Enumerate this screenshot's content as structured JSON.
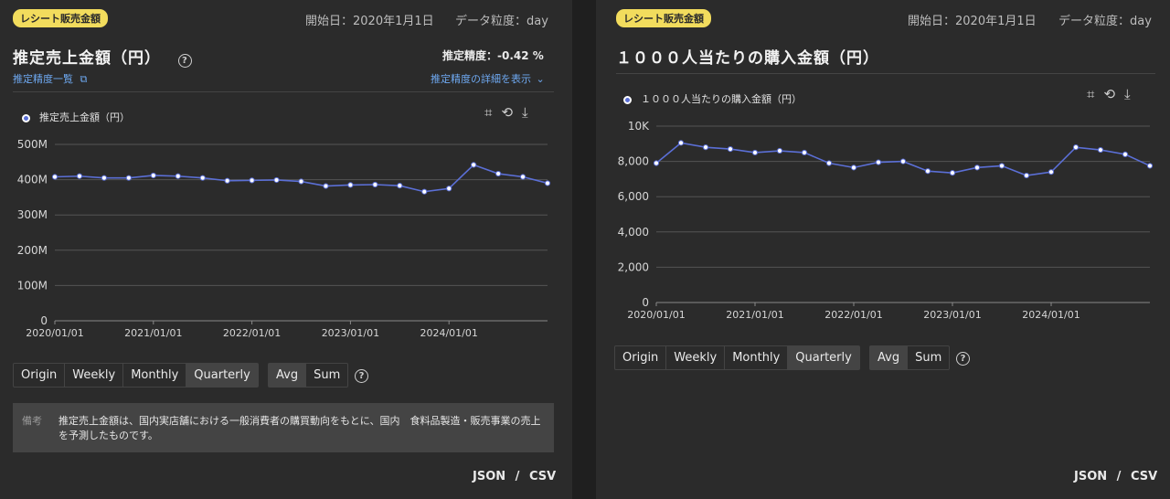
{
  "left": {
    "badge": "レシート販売金額",
    "start_date": "開始日：2020年1月1日",
    "granularity": "データ粒度：day",
    "title": "推定売上金額（円）",
    "accuracy": "推定精度：-0.42 %",
    "accuracy_list_link": "推定精度一覧",
    "accuracy_detail_link": "推定精度の詳細を表示",
    "legend": "推定売上金額（円）",
    "period_buttons": [
      "Origin",
      "Weekly",
      "Monthly",
      "Quarterly"
    ],
    "agg_buttons": [
      "Avg",
      "Sum"
    ],
    "note_label": "備考",
    "note_text": "推定売上金額は、国内実店舗における一般消費者の購買動向をもとに、国内　食料品製造・販売事業の売上を予測したものです。",
    "export": {
      "json": "JSON",
      "sep": "/",
      "csv": "CSV"
    }
  },
  "right": {
    "badge": "レシート販売金額",
    "start_date": "開始日：2020年1月1日",
    "granularity": "データ粒度：day",
    "title": "１０００人当たりの購入金額（円）",
    "legend": "１０００人当たりの購入金額（円）",
    "period_buttons": [
      "Origin",
      "Weekly",
      "Monthly",
      "Quarterly"
    ],
    "agg_buttons": [
      "Avg",
      "Sum"
    ],
    "export": {
      "json": "JSON",
      "sep": "/",
      "csv": "CSV"
    }
  },
  "colors": {
    "line": "#5b6fd6",
    "badge": "#f2dc5d",
    "link": "#6ea8f0"
  },
  "icons": [
    "crop-icon",
    "crop-reset-icon",
    "download-icon",
    "help-icon",
    "external-link-icon",
    "chevron-down-icon"
  ],
  "chart_data": [
    {
      "type": "line",
      "title": "推定売上金額（円）",
      "x": [
        "2020Q1",
        "2020Q2",
        "2020Q3",
        "2020Q4",
        "2021Q1",
        "2021Q2",
        "2021Q3",
        "2021Q4",
        "2022Q1",
        "2022Q2",
        "2022Q3",
        "2022Q4",
        "2023Q1",
        "2023Q2",
        "2023Q3",
        "2023Q4",
        "2024Q1",
        "2024Q2",
        "2024Q3",
        "2024Q4"
      ],
      "series": [
        {
          "name": "推定売上金額（円）",
          "values": [
            408,
            410,
            405,
            405,
            412,
            410,
            405,
            397,
            398,
            399,
            395,
            382,
            385,
            386,
            383,
            366,
            375,
            442,
            417,
            408,
            390
          ]
        }
      ],
      "ylim": [
        0,
        500
      ],
      "yticks": [
        "0",
        "100M",
        "200M",
        "300M",
        "400M",
        "500M"
      ],
      "xticks": [
        "2020/01/01",
        "2021/01/01",
        "2022/01/01",
        "2023/01/01",
        "2024/01/01"
      ],
      "grid": true
    },
    {
      "type": "line",
      "title": "１０００人当たりの購入金額（円）",
      "x": [
        "2020Q1",
        "2020Q2",
        "2020Q3",
        "2020Q4",
        "2021Q1",
        "2021Q2",
        "2021Q3",
        "2021Q4",
        "2022Q1",
        "2022Q2",
        "2022Q3",
        "2022Q4",
        "2023Q1",
        "2023Q2",
        "2023Q3",
        "2023Q4",
        "2024Q1",
        "2024Q2",
        "2024Q3",
        "2024Q4"
      ],
      "series": [
        {
          "name": "１０００人当たりの購入金額（円）",
          "values": [
            7900,
            9050,
            8800,
            8700,
            8500,
            8600,
            8500,
            7900,
            7650,
            7950,
            8000,
            7450,
            7350,
            7650,
            7750,
            7200,
            7400,
            8800,
            8650,
            8400,
            7750
          ]
        }
      ],
      "ylim": [
        0,
        10000
      ],
      "yticks": [
        "0",
        "2,000",
        "4,000",
        "6,000",
        "8,000",
        "10K"
      ],
      "xticks": [
        "2020/01/01",
        "2021/01/01",
        "2022/01/01",
        "2023/01/01",
        "2024/01/01"
      ],
      "grid": true
    }
  ]
}
